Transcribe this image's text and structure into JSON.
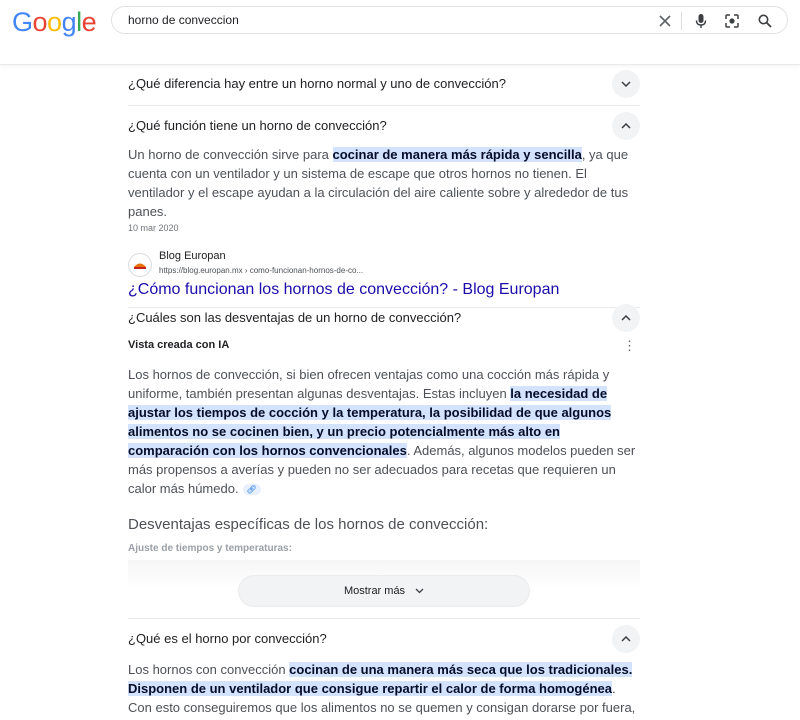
{
  "logo": {
    "letters": [
      "G",
      "o",
      "o",
      "g",
      "l",
      "e"
    ],
    "colors": [
      "#4285F4",
      "#EA4335",
      "#FBBC05",
      "#4285F4",
      "#34A853",
      "#EA4335"
    ]
  },
  "search": {
    "query": "horno de conveccion"
  },
  "icons": {
    "clear": "close-icon",
    "voice": "mic-icon",
    "lens": "lens-icon",
    "search": "search-icon"
  },
  "questions": [
    {
      "text": "¿Qué diferencia hay entre un horno normal y uno de convección?",
      "expanded": false
    },
    {
      "text": "¿Qué función tiene un horno de convección?",
      "expanded": true
    },
    {
      "text": "¿Cuáles son las desventajas de un horno de convección?",
      "expanded": true
    },
    {
      "text": "¿Qué es el horno por convección?",
      "expanded": true
    }
  ],
  "answer1": {
    "pre": "Un horno de convección sirve para ",
    "highlight": "cocinar de manera más rápida y sencilla",
    "post": ", ya que cuenta con un ventilador y un sistema de escape que otros hornos no tienen. El ventilador y el escape ayudan a la circulación del aire caliente sobre y alrededor de tus panes.",
    "date": "10 mar 2020"
  },
  "source": {
    "name": "Blog Europan",
    "url": "https://blog.europan.mx › como-funcionan-hornos-de-co...",
    "title": "¿Cómo funcionan los hornos de convección? - Blog Europan"
  },
  "answer2": {
    "ai_label": "Vista creada con IA",
    "pre": "Los hornos de convección, si bien ofrecen ventajas como una cocción más rápida y uniforme, también presentan algunas desventajas. Estas incluyen ",
    "highlight": "la necesidad de ajustar los tiempos de cocción y la temperatura, la posibilidad de que algunos alimentos no se cocinen bien, y un precio potencialmente más alto en comparación con los hornos convencionales",
    "post": ". Además, algunos modelos pueden ser más propensos a averías y pueden no ser adecuados para recetas que requieren un calor más húmedo.",
    "subheading": "Desventajas específicas de los hornos de convección:",
    "faded_item": "Ajuste de tiempos y temperaturas:",
    "show_more": "Mostrar más"
  },
  "answer3": {
    "pre": "Los hornos con convección ",
    "highlight": "cocinan de una manera más seca que los tradicionales. Disponen de un ventilador que consigue repartir el calor de forma homogénea",
    "post": ". Con esto conseguiremos que los alimentos no se quemen y consigan dorarse por fuera,"
  }
}
